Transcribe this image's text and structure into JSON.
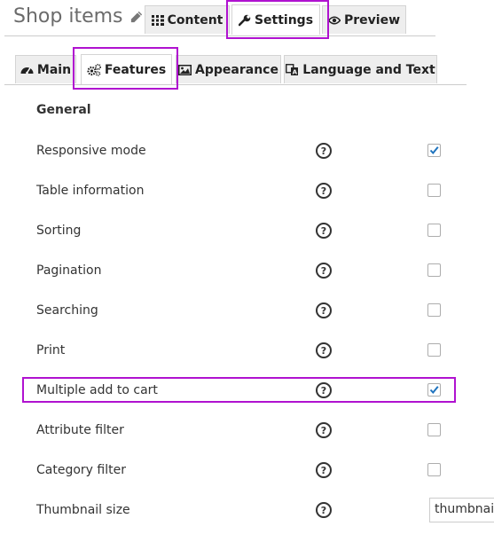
{
  "header": {
    "title": "Shop items",
    "tabs": [
      {
        "label": "Content",
        "icon": "grid-icon",
        "active": false
      },
      {
        "label": "Settings",
        "icon": "wrench-icon",
        "active": true
      },
      {
        "label": "Preview",
        "icon": "eye-icon",
        "active": false
      }
    ]
  },
  "subtabs": [
    {
      "label": "Main",
      "icon": "dashboard-icon",
      "active": false
    },
    {
      "label": "Features",
      "icon": "cogs-icon",
      "active": true
    },
    {
      "label": "Appearance",
      "icon": "image-icon",
      "active": false
    },
    {
      "label": "Language and Text",
      "icon": "language-icon",
      "active": false
    }
  ],
  "section": {
    "title": "General"
  },
  "settings": [
    {
      "label": "Responsive mode",
      "type": "checkbox",
      "checked": true
    },
    {
      "label": "Table information",
      "type": "checkbox",
      "checked": false
    },
    {
      "label": "Sorting",
      "type": "checkbox",
      "checked": false
    },
    {
      "label": "Pagination",
      "type": "checkbox",
      "checked": false
    },
    {
      "label": "Searching",
      "type": "checkbox",
      "checked": false
    },
    {
      "label": "Print",
      "type": "checkbox",
      "checked": false
    },
    {
      "label": "Multiple add to cart",
      "type": "checkbox",
      "checked": true
    },
    {
      "label": "Attribute filter",
      "type": "checkbox",
      "checked": false
    },
    {
      "label": "Category filter",
      "type": "checkbox",
      "checked": false
    },
    {
      "label": "Thumbnail size",
      "type": "select",
      "value": "thumbnail"
    }
  ],
  "help_glyph": "?",
  "colors": {
    "highlight": "#b012d0",
    "check": "#1e73be"
  }
}
